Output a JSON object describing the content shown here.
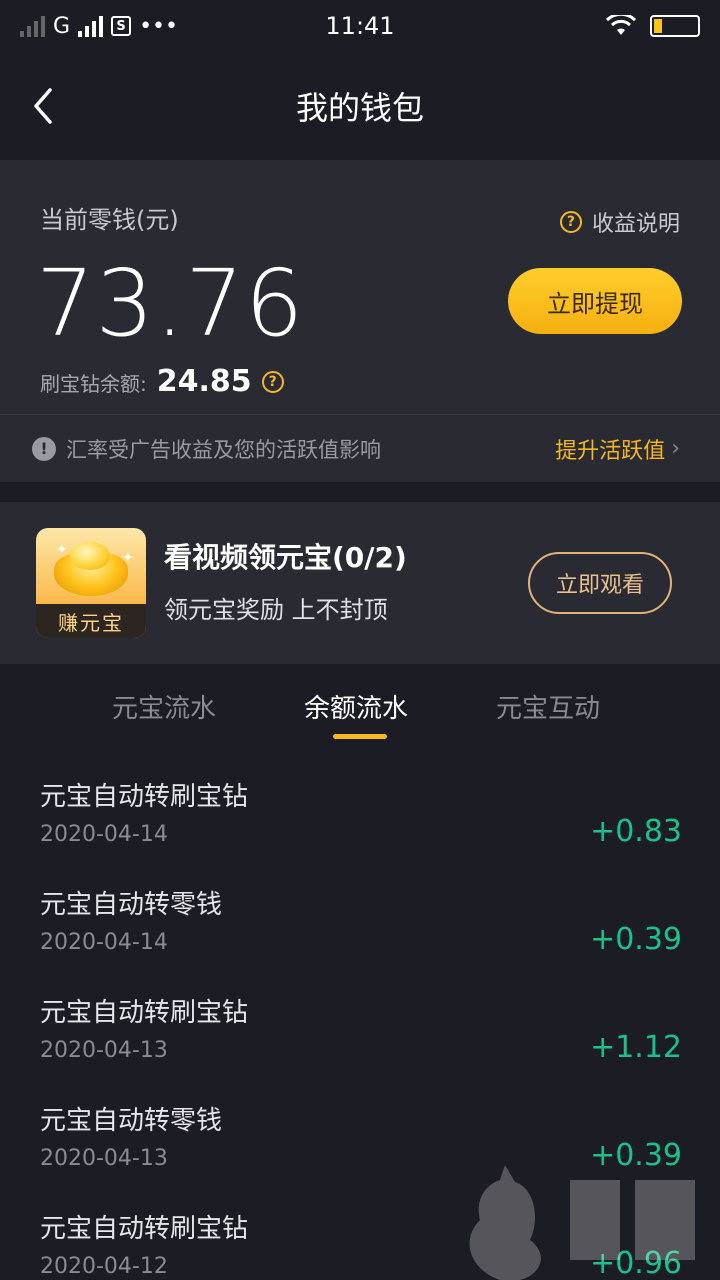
{
  "status_bar": {
    "network": "G",
    "time": "11:41",
    "sim_label": "S",
    "more": "•••"
  },
  "header": {
    "title": "我的钱包",
    "back_icon": "chevron-left-icon"
  },
  "balance": {
    "label": "当前零钱(元)",
    "amount": "73.76",
    "income_help": "收益说明",
    "withdraw_label": "立即提现",
    "diamond_label": "刷宝钻余额:",
    "diamond_value": "24.85",
    "notice": "汇率受广告收益及您的活跃值影响",
    "boost_label": "提升活跃值",
    "accent_color": "#f5b820"
  },
  "task": {
    "title": "看视频领元宝(0/2)",
    "desc": "领元宝奖励 上不封顶",
    "thumb_label": "赚元宝",
    "button_label": "立即观看"
  },
  "tabs": [
    {
      "label": "元宝流水",
      "active": false
    },
    {
      "label": "余额流水",
      "active": true
    },
    {
      "label": "元宝互动",
      "active": false
    }
  ],
  "transactions": [
    {
      "title": "元宝自动转刷宝钻",
      "date": "2020-04-14",
      "amount": "+0.83"
    },
    {
      "title": "元宝自动转零钱",
      "date": "2020-04-14",
      "amount": "+0.39"
    },
    {
      "title": "元宝自动转刷宝钻",
      "date": "2020-04-13",
      "amount": "+1.12"
    },
    {
      "title": "元宝自动转零钱",
      "date": "2020-04-13",
      "amount": "+0.39"
    },
    {
      "title": "元宝自动转刷宝钻",
      "date": "2020-04-12",
      "amount": "+0.96"
    }
  ],
  "colors": {
    "positive": "#19c28a",
    "background": "#1c1c24",
    "card": "#2a2a33"
  }
}
